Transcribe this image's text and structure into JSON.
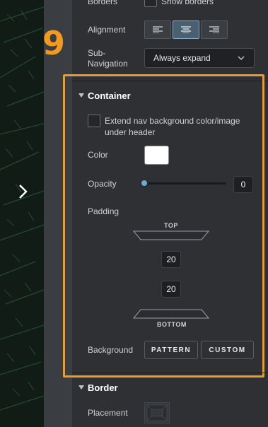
{
  "step_number": "9",
  "borders": {
    "label": "Borders",
    "checkbox_label": "Show borders"
  },
  "alignment": {
    "label": "Alignment",
    "options": [
      "left",
      "center",
      "right"
    ],
    "selected": "center"
  },
  "sub_navigation": {
    "label": "Sub-Navigation",
    "value": "Always expand"
  },
  "container": {
    "title": "Container",
    "extend_bg_label": "Extend nav background color/image under header",
    "color_label": "Color",
    "color_value": "#ffffff",
    "opacity_label": "Opacity",
    "opacity_value": "0",
    "padding_label": "Padding",
    "padding_top_caption": "TOP",
    "padding_top_value": "20",
    "padding_bottom_value": "20",
    "padding_bottom_caption": "BOTTOM",
    "background_label": "Background",
    "pattern_button": "PATTERN",
    "custom_button": "CUSTOM"
  },
  "border_section": {
    "title": "Border",
    "placement_label": "Placement"
  },
  "colors": {
    "accent_orange": "#f39a1e",
    "slider_blue": "#6fa9d4",
    "active_segment": "#4a6070"
  }
}
